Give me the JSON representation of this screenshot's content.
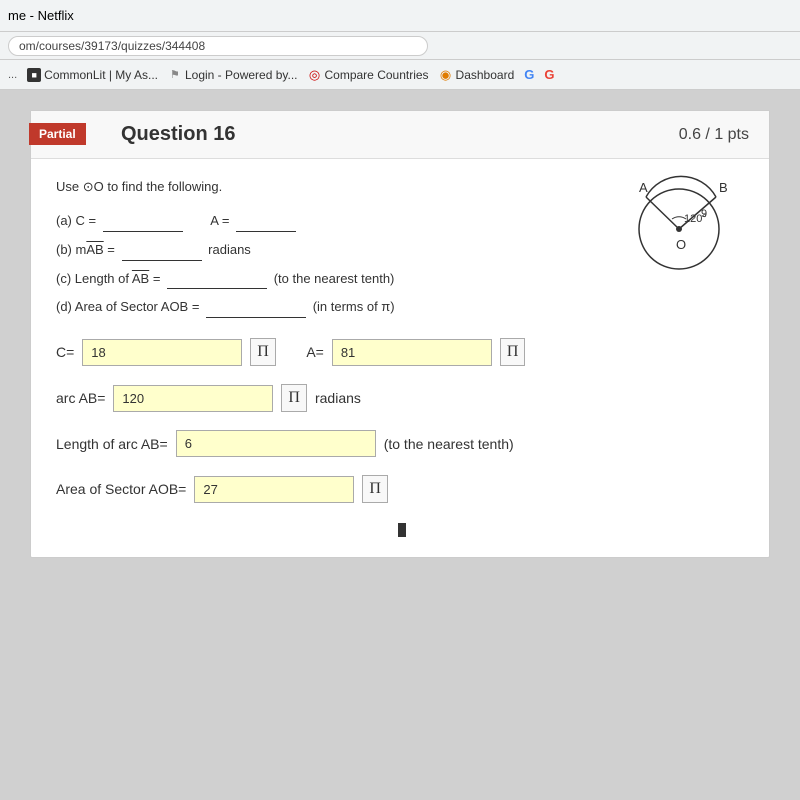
{
  "browser": {
    "title": "me - Netflix",
    "address": "om/courses/39173/quizzes/344408",
    "bookmarks": [
      {
        "label": "CommonLit | My As...",
        "icon": "book-icon"
      },
      {
        "label": "Login - Powered by...",
        "icon": "login-icon"
      },
      {
        "label": "Compare Countries",
        "icon": "compare-icon"
      },
      {
        "label": "Dashboard",
        "icon": "dashboard-icon"
      },
      {
        "label": "G",
        "icon": "google-icon"
      },
      {
        "label": "G",
        "icon": "google-red-icon"
      }
    ]
  },
  "question": {
    "badge": "Partial",
    "title": "Question 16",
    "score": "0.6 / 1 pts",
    "instructions": "Use ⊙O to find the following.",
    "parts": [
      {
        "label": "(a) C =",
        "blank": "_______",
        "label2": "A =",
        "blank2": "_______"
      },
      {
        "label": "(b) mAB =",
        "blank": "_______",
        "suffix": "radians"
      },
      {
        "label": "(c) Length of AB =",
        "blank": "_________",
        "suffix": "(to the nearest tenth)"
      },
      {
        "label": "(d) Area of Sector AOB =",
        "blank": "_________",
        "suffix": "(in terms of π)"
      }
    ],
    "answers": {
      "c_label": "C=",
      "c_value": "18",
      "a_label": "A=",
      "a_value": "81",
      "arc_label": "arc AB=",
      "arc_value": "120",
      "arc_suffix": "radians",
      "length_label": "Length of arc AB=",
      "length_value": "6",
      "length_suffix": "(to the nearest tenth)",
      "area_label": "Area of Sector AOB=",
      "area_value": "27",
      "pi_symbol": "π"
    },
    "diagram": {
      "angle": "120°",
      "radius": "9",
      "point_a": "A",
      "point_b": "B",
      "point_o": "O"
    }
  }
}
